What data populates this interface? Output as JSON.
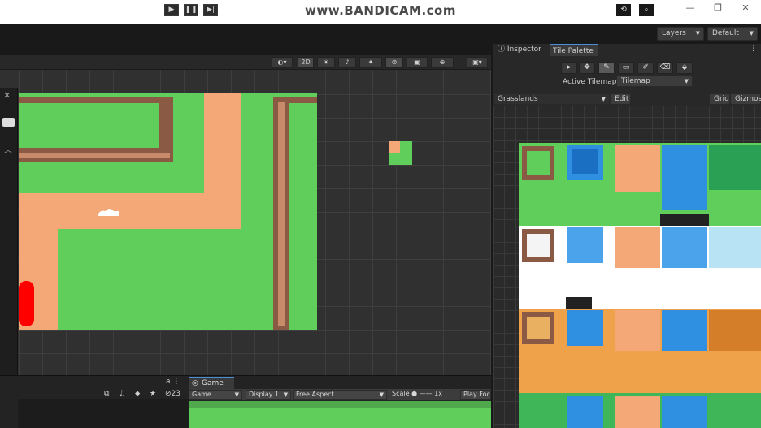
{
  "watermark": "www.BANDICAM.com",
  "window_controls": {
    "minimize": "—",
    "maximize": "❐",
    "close": "✕"
  },
  "toolbar": {
    "play_icon": "▶",
    "pause_icon": "❚❚",
    "step_icon": "▶|",
    "history_icon": "⟲",
    "search_icon": "⌕",
    "layers_label": "Layers",
    "layout_label": "Default"
  },
  "scene_toolbar": {
    "mode_2d": "2D",
    "light_icon": "☀",
    "audio_icon": "♪",
    "effects_icon": "✦",
    "visibility_icon": "⊘",
    "camera_icon": "▣",
    "gizmo_icon": "⊕"
  },
  "bottom": {
    "counter": "23",
    "game_tab_label": "Game",
    "game_dropdown": "Game",
    "display_dropdown": "Display 1",
    "aspect_dropdown": "Free Aspect",
    "scale_label": "Scale",
    "scale_value": "1x",
    "play_focused_label": "Play Foc"
  },
  "right_panel": {
    "inspector_tab": "Inspector",
    "tile_palette_tab": "Tile Palette",
    "active_tilemap_label": "Active Tilemap",
    "active_tilemap_value": "Tilemap",
    "palette_dropdown": "Grasslands",
    "edit_button": "Edit",
    "grid_button": "Grid",
    "gizmos_button": "Gizmos"
  },
  "palette_tools": [
    "▸",
    "✥",
    "✎",
    "▭",
    "✐",
    "⌫",
    "⬙"
  ],
  "colors": {
    "accent": "#4b8ed6",
    "grass": "#5fce5b",
    "dirt": "#f4a878",
    "water": "#2f8fe0",
    "player": "#ff0000"
  }
}
